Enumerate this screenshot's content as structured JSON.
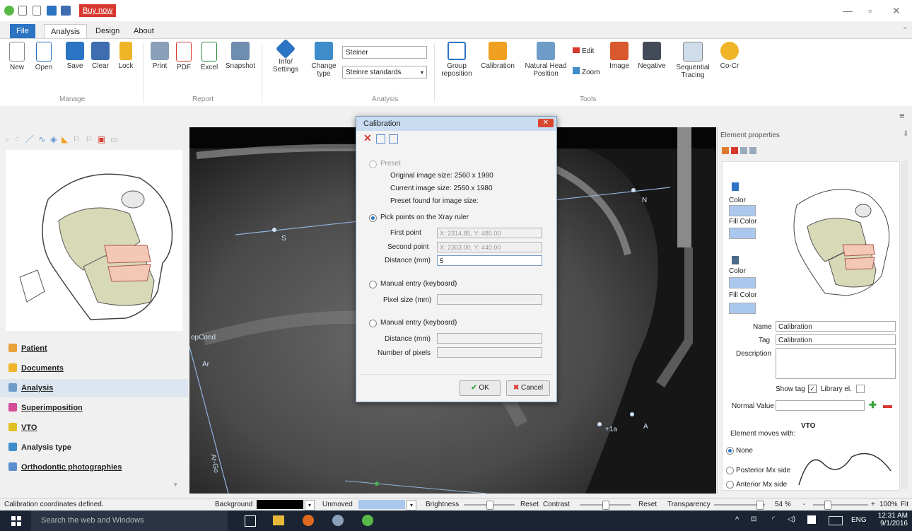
{
  "titlebar": {
    "buy_now": "Buy now"
  },
  "tabs": [
    "File",
    "Analysis",
    "Design",
    "About"
  ],
  "ribbon": {
    "manage": {
      "group": "Manage",
      "buttons": [
        "New",
        "Open",
        "Save",
        "Clear",
        "Lock"
      ]
    },
    "report": {
      "group": "Report",
      "buttons": [
        "Print",
        "PDF",
        "Excel",
        "Snapshot"
      ]
    },
    "analysis": {
      "group": "Analysis",
      "info": "Info/ Settings",
      "change_type": "Change type",
      "analysis_name": "Steiner",
      "standards": "Steinre standards"
    },
    "tools": {
      "group": "Tools",
      "buttons": [
        "Group reposition",
        "Calibration",
        "Natural Head Position",
        "Image",
        "Negative",
        "Sequential Tracing",
        "Co-Cr"
      ],
      "edit": "Edit",
      "zoom": "Zoom"
    }
  },
  "nav": [
    "Patient",
    "Documents",
    "Analysis",
    "Superimposition",
    "VTO",
    "Analysis type",
    "Orthodontic photographies"
  ],
  "landmarks": [
    "N",
    "S",
    "opCond",
    "Ar",
    "Ar-Go",
    "A",
    "+1a"
  ],
  "dialog": {
    "title": "Calibration",
    "preset": "Preset",
    "original_size": "Original image size: 2560 x 1980",
    "current_size": "Current image size: 2560 x 1980",
    "preset_found": "Preset found for image size:",
    "pick_points": "Pick points on the Xray ruler",
    "first_point_label": "First point",
    "first_point_value": "X: 2314.85, Y: 485.00",
    "second_point_label": "Second point",
    "second_point_value": "X: 2303.00, Y: 440.00",
    "distance_label": "Distance (mm)",
    "distance_value": "5",
    "manual1": "Manual entry (keyboard)",
    "pixel_size_label": "Pixel size (mm)",
    "manual2": "Manual entry (keyboard)",
    "distance2_label": "Distance (mm)",
    "num_pixels_label": "Number of pixels",
    "ok": "OK",
    "cancel": "Cancel"
  },
  "props": {
    "header": "Element properties",
    "color1": "Color",
    "fill1": "Fill Color",
    "color2": "Color",
    "fill2": "Fill Color",
    "name_label": "Name",
    "name_value": "Calibration",
    "tag_label": "Tag",
    "tag_value": "Calibration",
    "description_label": "Description",
    "show_tag": "Show tag",
    "library_el": "Library el.",
    "normal_value": "Normal Value",
    "vto": "VTO",
    "moves_with": "Element moves with:",
    "opt_none": "None",
    "opt_posterior": "Posterior Mx side",
    "opt_anterior": "Anterior Mx side"
  },
  "statusbar": {
    "message": "Calibration coordinates defined.",
    "background": "Background",
    "unmoved": "Unmoved",
    "brightness": "Brightness",
    "reset1": "Reset",
    "contrast": "Contrast",
    "reset2": "Reset",
    "transparency": "Transparency",
    "transparency_pct": "54 %",
    "zoom": "100%",
    "fit": "Fit"
  },
  "taskbar": {
    "search": "Search the web and Windows",
    "lang": "ENG",
    "time": "12:31 AM",
    "date": "9/1/2016"
  }
}
